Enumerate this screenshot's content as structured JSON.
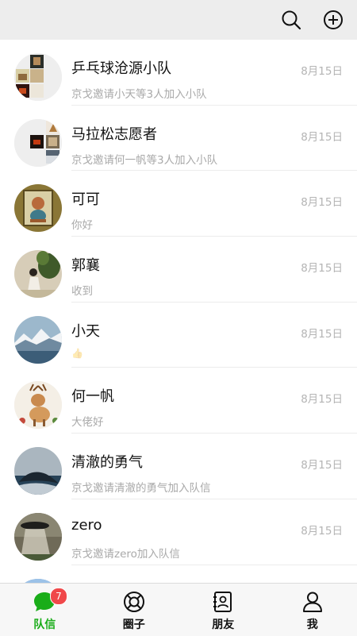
{
  "header": {
    "search_icon": "search-icon",
    "add_icon": "plus-circle-icon"
  },
  "conversations": [
    {
      "name": "乒乓球沧源小队",
      "time": "8月15日",
      "preview": "京戈邀请小天等3人加入小队"
    },
    {
      "name": "马拉松志愿者",
      "time": "8月15日",
      "preview": "京戈邀请何一帆等3人加入小队"
    },
    {
      "name": "可可",
      "time": "8月15日",
      "preview": "你好"
    },
    {
      "name": "郭襄",
      "time": "8月15日",
      "preview": "收到"
    },
    {
      "name": "小天",
      "time": "8月15日",
      "preview": "👍"
    },
    {
      "name": "何一帆",
      "time": "8月15日",
      "preview": "大佬好"
    },
    {
      "name": "清澈的勇气",
      "time": "8月15日",
      "preview": "京戈邀请清澈的勇气加入队信"
    },
    {
      "name": "zero",
      "time": "8月15日",
      "preview": "京戈邀请zero加入队信"
    }
  ],
  "tabs": [
    {
      "label": "队信",
      "badge": "7",
      "icon": "chat-bubble-icon"
    },
    {
      "label": "圈子",
      "icon": "lifebuoy-icon"
    },
    {
      "label": "朋友",
      "icon": "contacts-book-icon"
    },
    {
      "label": "我",
      "icon": "person-icon"
    }
  ],
  "colors": {
    "accent": "#1aad19",
    "badge": "#f0484a",
    "header_bg": "#ededed",
    "secondary_text": "#a9a9a9"
  }
}
